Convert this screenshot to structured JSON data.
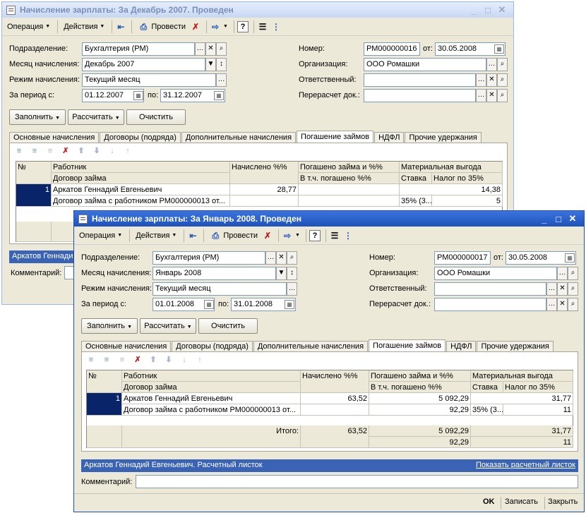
{
  "back": {
    "title": "Начисление зарплаты: За Декабрь 2007. Проведен",
    "toolbar": {
      "operation": "Операция",
      "actions": "Действия",
      "post": "Провести"
    },
    "fields": {
      "subdivision_label": "Подразделение:",
      "subdivision": "Бухгалтерия (РМ)",
      "month_label": "Месяц начисления:",
      "month": "Декабрь 2007",
      "mode_label": "Режим начисления:",
      "mode": "Текущий месяц",
      "period_label": "За период с:",
      "period_from": "01.12.2007",
      "period_to_label": "по:",
      "period_to": "31.12.2007",
      "number_label": "Номер:",
      "number": "РМ000000016",
      "date_label": "от:",
      "date": "30.05.2008",
      "org_label": "Организация:",
      "org": "ООО Ромашки",
      "responsible_label": "Ответственный:",
      "responsible": "",
      "recalc_label": "Перерасчет док.:",
      "recalc": ""
    },
    "buttons": {
      "fill": "Заполнить",
      "calc": "Рассчитать",
      "clear": "Очистить"
    },
    "tabs": [
      "Основные начисления",
      "Договоры (подряда)",
      "Дополнительные начисления",
      "Погашение займов",
      "НДФЛ",
      "Прочие удержания"
    ],
    "grid": {
      "h_num": "№",
      "h_worker": "Работник",
      "h_contract": "Договор займа",
      "h_accrued": "Начислено %%",
      "h_repaid": "Погашено займа и %%",
      "h_repaid_incl": "В т.ч. погашено %%",
      "h_benefit": "Материальная выгода",
      "h_rate": "Ставка",
      "h_tax": "Налог по 35%",
      "row_num": "1",
      "worker": "Аркатов Геннадий Евгеньевич",
      "contract": "Договор займа с работником РМ000000013 от...",
      "accrued": "28,77",
      "tax": "14,38",
      "rate": "35% (3...",
      "tax2": "5"
    },
    "infobar": "Аркатов Геннади",
    "comment_label": "Комментарий:"
  },
  "front": {
    "title": "Начисление зарплаты: За Январь 2008. Проведен",
    "toolbar": {
      "operation": "Операция",
      "actions": "Действия",
      "post": "Провести"
    },
    "fields": {
      "subdivision_label": "Подразделение:",
      "subdivision": "Бухгалтерия (РМ)",
      "month_label": "Месяц начисления:",
      "month": "Январь 2008",
      "mode_label": "Режим начисления:",
      "mode": "Текущий месяц",
      "period_label": "За период с:",
      "period_from": "01.01.2008",
      "period_to_label": "по:",
      "period_to": "31.01.2008",
      "number_label": "Номер:",
      "number": "РМ000000017",
      "date_label": "от:",
      "date": "30.05.2008",
      "org_label": "Организация:",
      "org": "ООО Ромашки",
      "responsible_label": "Ответственный:",
      "responsible": "",
      "recalc_label": "Перерасчет док.:",
      "recalc": ""
    },
    "buttons": {
      "fill": "Заполнить",
      "calc": "Рассчитать",
      "clear": "Очистить"
    },
    "tabs": [
      "Основные начисления",
      "Договоры (подряда)",
      "Дополнительные начисления",
      "Погашение займов",
      "НДФЛ",
      "Прочие удержания"
    ],
    "grid": {
      "h_num": "№",
      "h_worker": "Работник",
      "h_contract": "Договор займа",
      "h_accrued": "Начислено %%",
      "h_repaid": "Погашено займа и %%",
      "h_repaid_incl": "В т.ч. погашено %%",
      "h_benefit": "Материальная выгода",
      "h_rate": "Ставка",
      "h_tax": "Налог по 35%",
      "row_num": "1",
      "worker": "Аркатов Геннадий Евгеньевич",
      "contract": "Договор займа с работником РМ000000013 от...",
      "accrued": "63,52",
      "repaid": "5 092,29",
      "repaid_incl": "92,29",
      "tax": "31,77",
      "rate": "35% (3...",
      "tax2": "11",
      "total_label": "Итого:",
      "total_accrued": "63,52",
      "total_repaid": "5 092,29",
      "total_repaid_incl": "92,29",
      "total_tax": "31,77",
      "total_tax2": "11"
    },
    "infobar": "Аркатов Геннадий Евгеньевич. Расчетный листок",
    "infobar_link": "Показать расчетный листок",
    "comment_label": "Комментарий:",
    "footer": {
      "ok": "OK",
      "save": "Записать",
      "close": "Закрыть"
    }
  }
}
